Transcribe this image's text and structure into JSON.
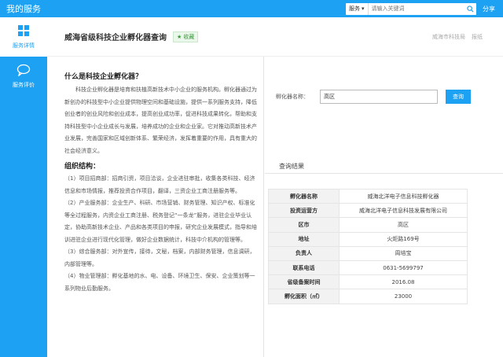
{
  "app": {
    "title": "我的服务",
    "share": "分享"
  },
  "search": {
    "category": "服务",
    "placeholder": "请输入关键词"
  },
  "nav": {
    "items": [
      {
        "label": "服务详情"
      },
      {
        "label": "服务评价"
      }
    ]
  },
  "header": {
    "title": "威海省级科技企业孵化器查询",
    "collect": "收藏",
    "links": [
      "威海市科技局",
      "报纸"
    ]
  },
  "intro": {
    "heading": "什么是科技企业孵化器？",
    "body": "科技企业孵化器是培育和扶植高新技术中小企业的服务机构。孵化器通过为新创办的科技型中小企业提供物理空间和基础设施，提供一系列服务支持，降低创业者的创业风险和创业成本，提高创业成功率，促进科技成果转化，帮助和支持科技型中小企业成长与发展，培养成功的企业和企业家。它对推动高新技术产业发展，完善国家和区域创新体系、繁荣经济，发挥着重要的作用，具有重大的社会经济意义。"
  },
  "org": {
    "heading": "组织结构：",
    "items": [
      "（1）项目招商部：招商引资，项目洽谈，企业进驻审批，收集各类科技、经济信息和市场情报，推荐投资合作项目，翻译，三资企业工商注册服务等。",
      "（2）产业服务部：企业生产、科研、市场营销、财务管理、知识产权、标准化等全过程服务，内资企业工商注册、税务登记“一条龙”服务，进驻企业毕业认定，协助高新技术企业、产品和各类项目的申报，研究企业发展模式，指导和培训进驻企业进行现代化管理，做好企业数据统计，科技中介机构的管理等。",
      "（3）综合服务部：对外宣传，接待，文秘，档案，内部财务管理，信息调研，内部管理等。",
      "（4）物业管理部：孵化基地的水、电、设备、环境卫生、保安、企业策划等一系列物业后勤服务。"
    ]
  },
  "query": {
    "label": "孵化器名称：",
    "value": "高区",
    "button": "查询"
  },
  "results": {
    "title": "查询结果",
    "rows": [
      {
        "key": "孵化器名称",
        "value": "威海北洋电子信息科技孵化器"
      },
      {
        "key": "投资运营方",
        "value": "威海北洋电子信息科技发展有限公司"
      },
      {
        "key": "区市",
        "value": "高区"
      },
      {
        "key": "地址",
        "value": "火炬路169号"
      },
      {
        "key": "负责人",
        "value": "周培宝"
      },
      {
        "key": "联系电话",
        "value": "0631-5699797"
      },
      {
        "key": "省级备案时间",
        "value": "2016.08"
      },
      {
        "key": "孵化面积（㎡）",
        "value": "23000"
      }
    ]
  },
  "colors": {
    "accent": "#1da1f2",
    "collect_green": "#3a9a3a"
  }
}
